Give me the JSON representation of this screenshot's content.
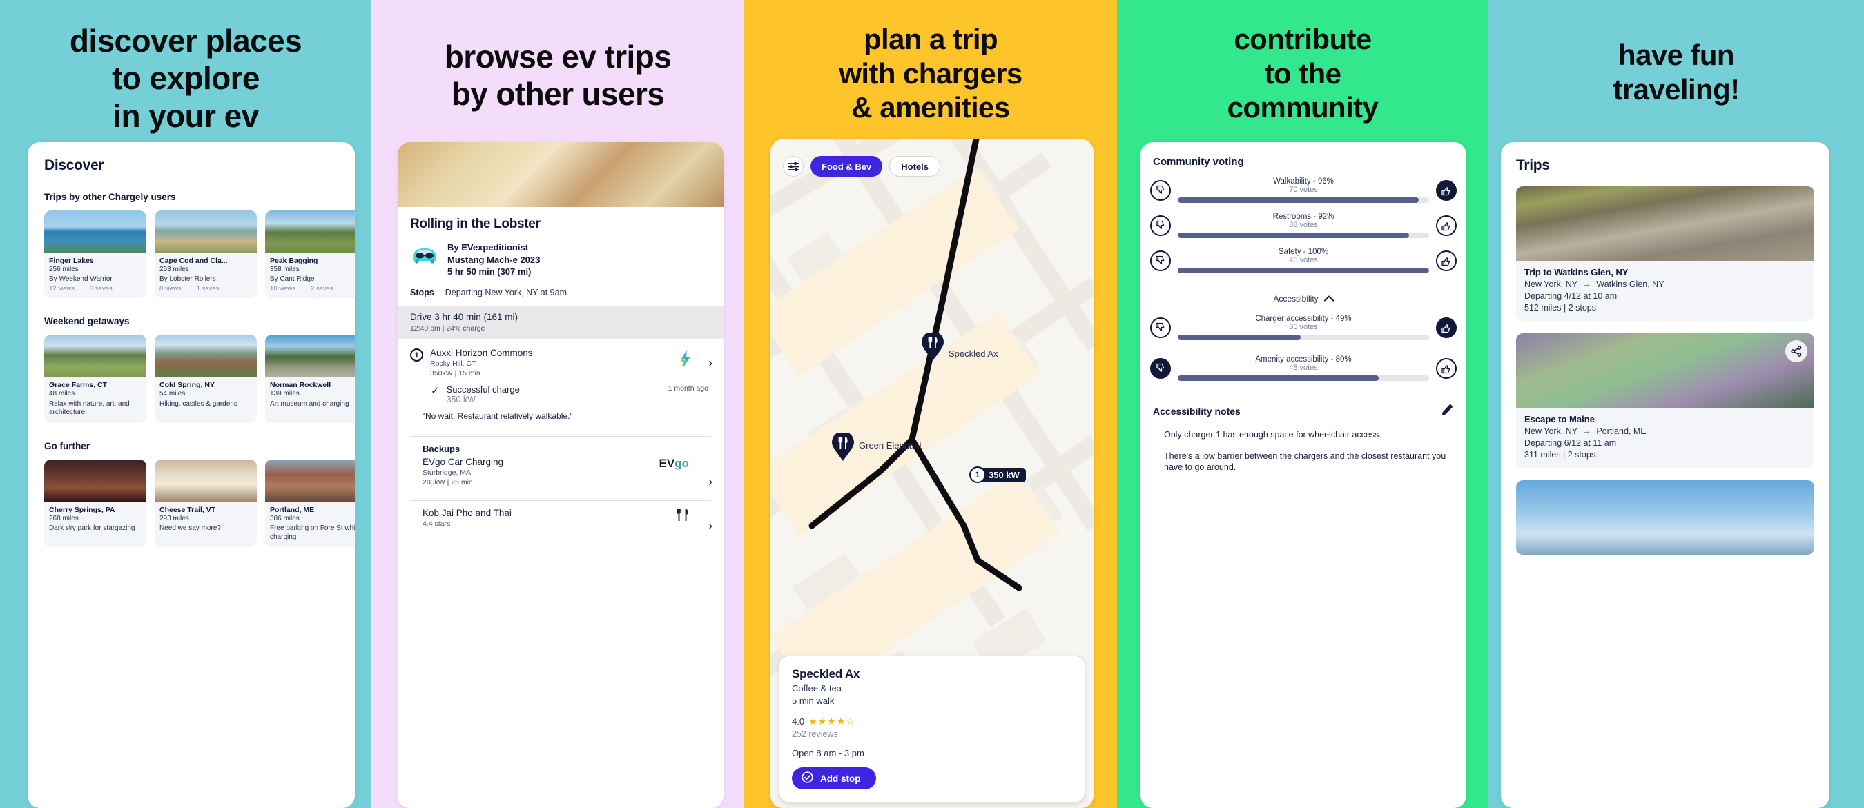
{
  "panels": [
    {
      "headline": "discover places\nto explore\nin your ev",
      "bg": "#74cfd6"
    },
    {
      "headline": "browse ev trips\nby other users",
      "bg": "#f4ddfb"
    },
    {
      "headline": "plan a trip\nwith chargers\n& amenities",
      "bg": "#fdc52a"
    },
    {
      "headline": "contribute\nto the\ncommunity",
      "bg": "#33e78c"
    },
    {
      "headline": "have fun\ntraveling!",
      "bg": "#74cfd6"
    }
  ],
  "discover": {
    "title": "Discover",
    "sections": [
      {
        "heading": "Trips by other Chargely users",
        "cards": [
          {
            "name": "Finger Lakes",
            "miles": "256 miles",
            "by": "By Weekend Warrior",
            "views": "12 views",
            "saves": "3 saves"
          },
          {
            "name": "Cape Cod and Cla...",
            "miles": "253 miles",
            "by": "By Lobster Rollers",
            "views": "8 views",
            "saves": "1 saves"
          },
          {
            "name": "Peak Bagging",
            "miles": "358 miles",
            "by": "By Cant Ridge",
            "views": "10 views",
            "saves": "2 saves"
          }
        ]
      },
      {
        "heading": "Weekend getaways",
        "cards": [
          {
            "name": "Grace Farms, CT",
            "miles": "48 miles",
            "desc": "Relax with nature, art, and architecture"
          },
          {
            "name": "Cold Spring, NY",
            "miles": "54 miles",
            "desc": "Hiking, castles & gardens"
          },
          {
            "name": "Norman Rockwell",
            "miles": "139 miles",
            "desc": "Art museum and charging"
          }
        ]
      },
      {
        "heading": "Go further",
        "cards": [
          {
            "name": "Cherry Springs, PA",
            "miles": "268 miles",
            "desc": "Dark sky park for stargazing"
          },
          {
            "name": "Cheese Trail, VT",
            "miles": "293 miles",
            "desc": "Need we say more?"
          },
          {
            "name": "Portland, ME",
            "miles": "306 miles",
            "desc": "Free parking on Fore St while charging"
          }
        ]
      }
    ]
  },
  "trip_detail": {
    "title": "Rolling in the Lobster",
    "author": "By EVexpeditionist",
    "vehicle": "Mustang Mach-e 2023",
    "duration": "5 hr 50 min  (307 mi)",
    "stops_label": "Stops",
    "departing": "Departing New York, NY at 9am",
    "drive_main": "Drive 3 hr 40 min (161 mi)",
    "drive_sub": "12:40 pm | 24% charge",
    "stop": {
      "number": "1",
      "name": "Auxxi Horizon Commons",
      "city": "Rocky Hill, CT",
      "spec": "350kW | 15 min",
      "charge_status": "Successful charge",
      "charge_kw": "350 kW",
      "charge_ago": "1 month ago",
      "quote": "“No wait. Restaurant relatively walkable.”"
    },
    "backups_label": "Backups",
    "backups": [
      {
        "name": "EVgo Car Charging",
        "city": "Sturbridge, MA",
        "spec": "200kW | 25 min",
        "brand": "EVgo"
      },
      {
        "name": "Kob Jai Pho and Thai",
        "city": "4.4 stars",
        "spec": "",
        "brand": "restaurant-icon"
      }
    ]
  },
  "map_screen": {
    "filter_icon": "sliders-icon",
    "chips": [
      {
        "label": "Food & Bev",
        "active": true
      },
      {
        "label": "Hotels",
        "active": false
      }
    ],
    "pins": [
      {
        "label": "Speckled Ax",
        "icon": "restaurant-pin"
      },
      {
        "label": "Green Elephant",
        "icon": "restaurant-pin"
      }
    ],
    "charger_badge": {
      "number": "1",
      "power": "350 kW"
    },
    "poi": {
      "name": "Speckled Ax",
      "category": "Coffee & tea",
      "walk": "5 min walk",
      "rating": "4.0",
      "stars_filled": 4,
      "stars_total": 5,
      "reviews": "252 reviews",
      "hours": "Open 8 am - 3 pm",
      "cta": "Add stop"
    }
  },
  "community": {
    "title": "Community voting",
    "items": [
      {
        "label": "Walkability - 96%",
        "votes": "70 votes",
        "pct": 96,
        "up_filled": true,
        "down_filled": false
      },
      {
        "label": "Restrooms - 92%",
        "votes": "88 votes",
        "pct": 92,
        "up_filled": false,
        "down_filled": false
      },
      {
        "label": "Safety - 100%",
        "votes": "45 votes",
        "pct": 100,
        "up_filled": false,
        "down_filled": false
      }
    ],
    "accessibility_heading": "Accessibility",
    "accessibility_items": [
      {
        "label": "Charger accessibility - 49%",
        "votes": "35 votes",
        "pct": 49,
        "up_filled": true,
        "down_filled": false
      },
      {
        "label": "Amenity accessibility - 80%",
        "votes": "48 votes",
        "pct": 80,
        "up_filled": false,
        "down_filled": true
      }
    ],
    "notes_title": "Accessibility notes",
    "notes": [
      "Only charger 1 has enough space for wheelchair access.",
      "There's a low barrier between the chargers and the closest restaurant you have to go around."
    ]
  },
  "trips": {
    "title": "Trips",
    "items": [
      {
        "name": "Trip to Watkins Glen, NY",
        "from": "New York, NY",
        "to": "Watkins Glen, NY",
        "departing": "Departing 4/12 at 10 am",
        "stats": "512 miles | 2 stops",
        "shareable": false
      },
      {
        "name": "Escape to Maine",
        "from": "New York, NY",
        "to": "Portland, ME",
        "departing": "Departing 6/12 at 11 am",
        "stats": "311 miles | 2 stops",
        "shareable": true
      },
      {
        "name": "",
        "from": "",
        "to": "",
        "departing": "",
        "stats": "",
        "shareable": false
      }
    ]
  },
  "colors": {
    "navy": "#111839",
    "purple": "#4025e0",
    "bar": "#585e8e",
    "star": "#f5b417"
  }
}
